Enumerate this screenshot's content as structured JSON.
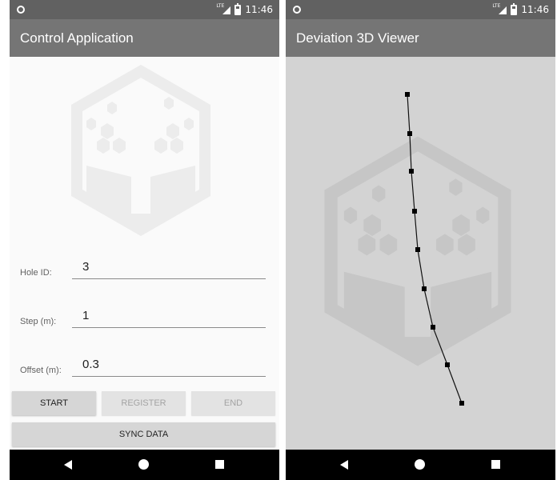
{
  "left_screen": {
    "status": {
      "time": "11:46",
      "network": "LTE"
    },
    "title": "Control Application",
    "fields": [
      {
        "label": "Hole ID:",
        "value": "3"
      },
      {
        "label": "Step (m):",
        "value": "1"
      },
      {
        "label": "Offset (m):",
        "value": "0.3"
      }
    ],
    "buttons": {
      "start": "START",
      "register": "REGISTER",
      "end": "END",
      "sync": "SYNC DATA"
    },
    "button_states": {
      "start": "enabled",
      "register": "disabled",
      "end": "disabled",
      "sync": "enabled"
    }
  },
  "right_screen": {
    "status": {
      "time": "11:46",
      "network": "LTE"
    },
    "title": "Deviation 3D Viewer",
    "deviation_points": 9
  },
  "colors": {
    "status_bar": "#616161",
    "app_bar": "#757575",
    "left_background": "#fafafa",
    "viewer_background": "#d3d3d3",
    "button": "#d6d6d6",
    "button_disabled_text": "#a3a3a3",
    "nav_bar": "#000000"
  },
  "icons": [
    "notification-dot-icon",
    "lte-signal-icon",
    "battery-icon",
    "back-icon",
    "home-icon",
    "recents-icon",
    "logo-watermark-icon"
  ]
}
